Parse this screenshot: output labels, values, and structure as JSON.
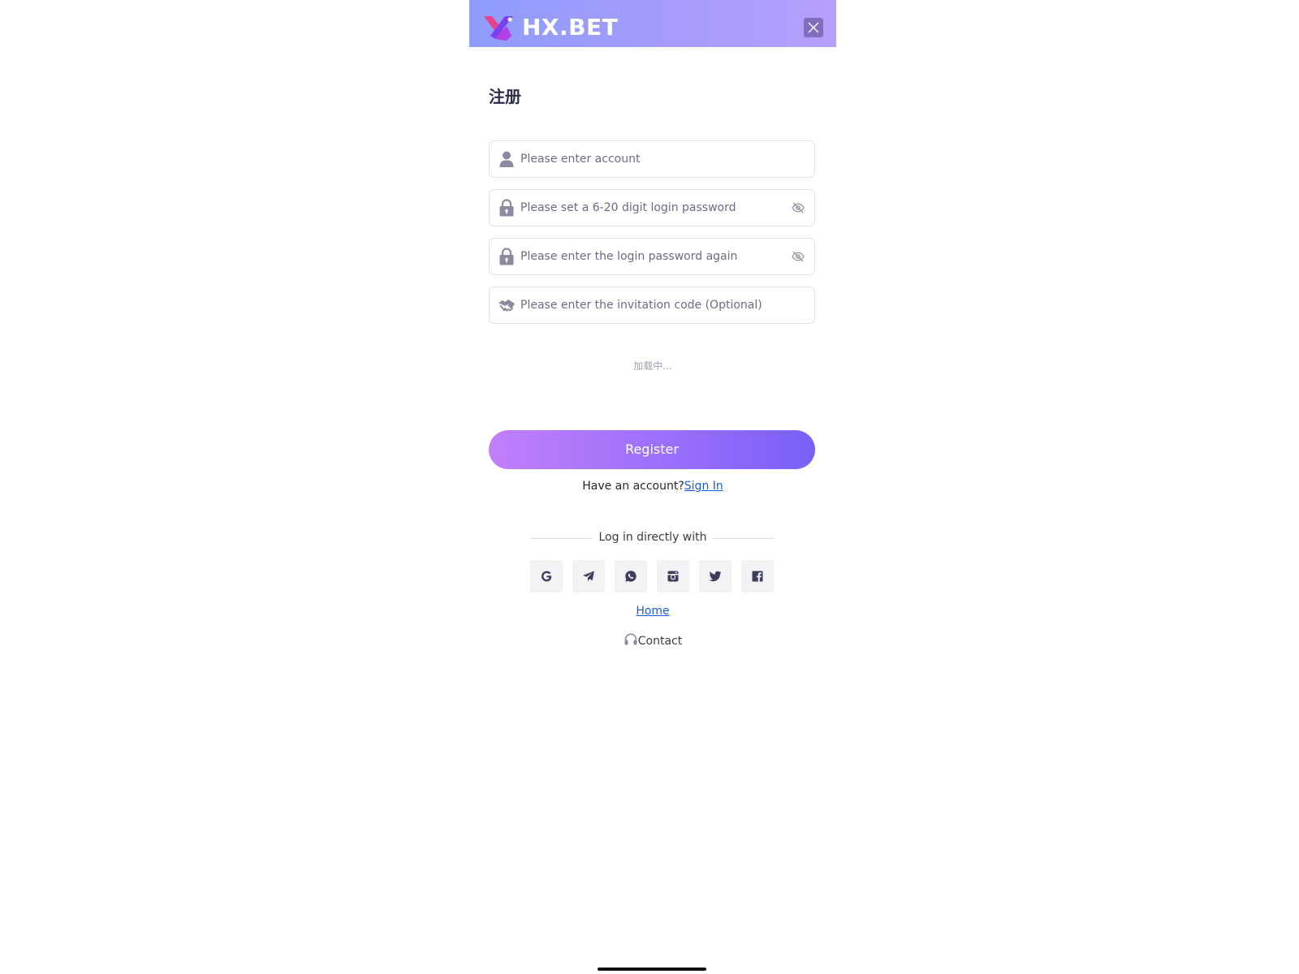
{
  "header": {
    "brand": "HX.BET",
    "logo_icon": "hx-logo-icon",
    "close_icon": "close-icon"
  },
  "page": {
    "title": "注册"
  },
  "form": {
    "account": {
      "placeholder": "Please enter account",
      "value": "",
      "icon": "user-icon"
    },
    "password": {
      "placeholder": "Please set a 6-20 digit login password",
      "value": "",
      "icon": "lock-icon",
      "toggle_icon": "eye-off-icon"
    },
    "confirm_password": {
      "placeholder": "Please enter the login password again",
      "value": "",
      "icon": "lock-icon",
      "toggle_icon": "eye-off-icon"
    },
    "invitation_code": {
      "placeholder": "Please enter the invitation code (Optional)",
      "value": "",
      "icon": "handshake-icon"
    },
    "loading_text": "加载中...",
    "register_label": "Register"
  },
  "signin": {
    "prompt": "Have an account?",
    "link": "Sign In"
  },
  "social_login": {
    "label": "Log in directly with",
    "providers": [
      {
        "name": "google",
        "icon": "google-icon"
      },
      {
        "name": "telegram",
        "icon": "telegram-icon"
      },
      {
        "name": "whatsapp",
        "icon": "whatsapp-icon"
      },
      {
        "name": "instagram",
        "icon": "instagram-icon"
      },
      {
        "name": "twitter",
        "icon": "twitter-icon"
      },
      {
        "name": "facebook",
        "icon": "facebook-icon"
      }
    ]
  },
  "footer": {
    "home": "Home",
    "contact": "Contact",
    "contact_icon": "headset-icon"
  },
  "colors": {
    "header_gradient_start": "#8e9dfc",
    "header_gradient_end": "#b79ffc",
    "button_gradient_start": "#c27ffb",
    "button_gradient_end": "#7a5ff8",
    "link": "#1a5fe0",
    "icon_gray": "#8a8aa0",
    "social_icon": "#3d3d5c"
  }
}
